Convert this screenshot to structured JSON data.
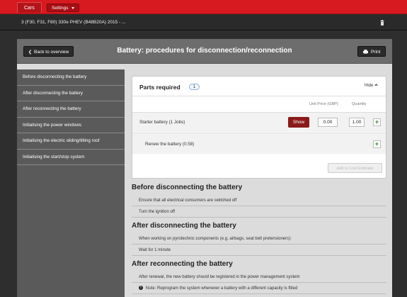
{
  "topbar": {
    "tab_label": "Cars",
    "settings_label": "Settings"
  },
  "vehicle": {
    "name": "3 (F30, F31, F80) 330e PHEV (B48B20A) 2015 - ..."
  },
  "header": {
    "back_label": "Back to overview",
    "title": "Battery: procedures for disconnection/reconnection",
    "print_label": "Print"
  },
  "sidebar": {
    "items": [
      "Before disconnecting the battery",
      "After disconnecting the battery",
      "After reconnecting the battery",
      "Initialising the power windows",
      "Initialising the electric sliding/tilting roof",
      "Initialising the start/stop system"
    ]
  },
  "parts": {
    "title": "Parts required",
    "count": "1",
    "hide_label": "Hide",
    "col_unit_price": "Unit Price (GBP)",
    "col_quantity": "Quantity",
    "item_label": "Starter battery (1 Jobs)",
    "show_label": "Show",
    "unit_price": "0.00",
    "quantity": "1.00",
    "job_label": "Renew the battery (0.58)",
    "add_label": "Add to Cost Estimate"
  },
  "sections": [
    {
      "title": "Before disconnecting the battery",
      "steps": [
        "Ensure that all electrical consumers are switched off",
        "Turn the ignition off"
      ]
    },
    {
      "title": "After disconnecting the battery",
      "steps": [
        "When working on pyrotechnic components (e.g. airbags, seat belt pretensioners):",
        "Wait for 1 minute"
      ]
    },
    {
      "title": "After reconnecting the battery",
      "steps": [
        "After renewal, the new battery should be registered in the power management system",
        "Note: Reprogram the system whenever a battery with a different capacity is fitted"
      ]
    }
  ],
  "colors": {
    "brand_red": "#d71920",
    "show_button": "#8b1a1a",
    "plus_green": "#2f8a2f"
  },
  "icons": {
    "back": "chevron-left-icon",
    "print": "printer-icon",
    "trash": "trash-icon",
    "hide": "chevron-up-icon",
    "add": "plus-icon",
    "note": "info-icon"
  }
}
